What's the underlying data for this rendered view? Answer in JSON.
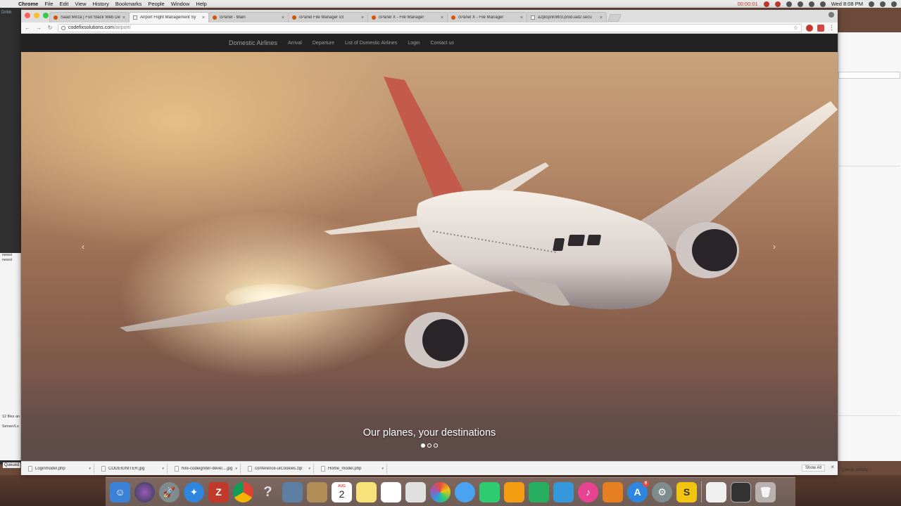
{
  "menubar": {
    "app": "Chrome",
    "items": [
      "File",
      "Edit",
      "View",
      "History",
      "Bookmarks",
      "People",
      "Window",
      "Help"
    ],
    "recording_time": "00:00:01",
    "clock": "Wed 8:08 PM"
  },
  "tabs": [
    {
      "label": "Saad Mirza | Full Stack Web De",
      "icon": "dribbble-favicon"
    },
    {
      "label": "Airport Flight Management Sy",
      "icon": "document-favicon",
      "active": true
    },
    {
      "label": "cPanel - Main",
      "icon": "cpanel-favicon"
    },
    {
      "label": "cPanel File Manager v3",
      "icon": "cpanel-favicon"
    },
    {
      "label": "cPanel X - File Manager",
      "icon": "cpanel-favicon"
    },
    {
      "label": "cPanel X - File Manager",
      "icon": "cpanel-favicon"
    },
    {
      "label": "a2plcpnl0803.prod.iad2.secu",
      "icon": "document-favicon"
    }
  ],
  "address": {
    "host": "codefixsolutions.com",
    "path": "/airport/"
  },
  "site": {
    "brand": "Domestic Airlines",
    "nav": [
      "Arrival",
      "Departure",
      "List of Domestic Airlines",
      "Login",
      "Contact us"
    ]
  },
  "carousel": {
    "caption": "Our planes, your destinations",
    "prev": "‹",
    "next": "›",
    "slides": 3,
    "active_slide": 1
  },
  "downloads": {
    "items": [
      "Loginmodel.php",
      "CODEIGNITER.jpg",
      "hire-codeigniter-devel....jpg",
      "conference-uiCookies.zip",
      "Home_model.php"
    ],
    "show_all": "Show All"
  },
  "background": {
    "left_items": [
      "newsi",
      "newsi"
    ],
    "left_status": "12 files an",
    "left_server": "Server/Lo",
    "queues_label": "Queued",
    "queue_status": "Queue: empty",
    "left_top_label": "Dribb"
  },
  "dock": {
    "calendar_month": "AUG",
    "calendar_day": "2",
    "appstore_badge": "6",
    "colors": {
      "finder": "#3b82d6",
      "siri": "#6a5acd",
      "filezilla": "#c0392b",
      "chrome": "#e8e8e8"
    }
  }
}
